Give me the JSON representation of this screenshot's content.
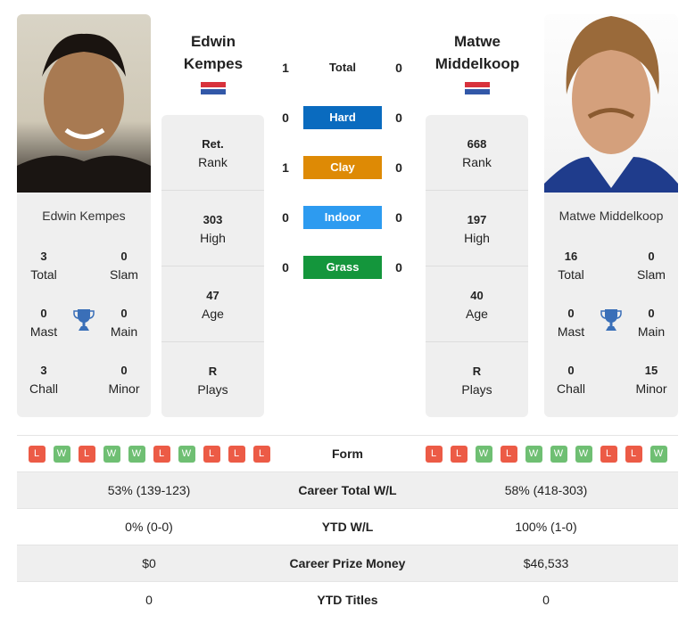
{
  "colors": {
    "hard": "#0a6bbf",
    "clay": "#de8a05",
    "indoor": "#2d9bf0",
    "grass": "#14963c",
    "win": "#6fbf73",
    "loss": "#ec5b46",
    "trophy": "#3a6fb8"
  },
  "player1": {
    "name_line1": "Edwin",
    "name_line2": "Kempes",
    "full_name": "Edwin Kempes",
    "country_flag": "netherlands-flag",
    "rank": "Ret.",
    "rank_label": "Rank",
    "high": "303",
    "high_label": "High",
    "age": "47",
    "age_label": "Age",
    "plays": "R",
    "plays_label": "Plays",
    "titles": {
      "total": "3",
      "total_label": "Total",
      "slam": "0",
      "slam_label": "Slam",
      "mast": "0",
      "mast_label": "Mast",
      "main": "0",
      "main_label": "Main",
      "chall": "3",
      "chall_label": "Chall",
      "minor": "0",
      "minor_label": "Minor"
    },
    "form": [
      "L",
      "W",
      "L",
      "W",
      "W",
      "L",
      "W",
      "L",
      "L",
      "L"
    ],
    "career_wl": "53% (139-123)",
    "ytd_wl": "0% (0-0)",
    "prize_money": "$0",
    "ytd_titles": "0"
  },
  "player2": {
    "name_line1": "Matwe",
    "name_line2": "Middelkoop",
    "full_name": "Matwe Middelkoop",
    "country_flag": "netherlands-flag",
    "rank": "668",
    "rank_label": "Rank",
    "high": "197",
    "high_label": "High",
    "age": "40",
    "age_label": "Age",
    "plays": "R",
    "plays_label": "Plays",
    "titles": {
      "total": "16",
      "total_label": "Total",
      "slam": "0",
      "slam_label": "Slam",
      "mast": "0",
      "mast_label": "Mast",
      "main": "0",
      "main_label": "Main",
      "chall": "0",
      "chall_label": "Chall",
      "minor": "15",
      "minor_label": "Minor"
    },
    "form": [
      "L",
      "L",
      "W",
      "L",
      "W",
      "W",
      "W",
      "L",
      "L",
      "W"
    ],
    "career_wl": "58% (418-303)",
    "ytd_wl": "100% (1-0)",
    "prize_money": "$46,533",
    "ytd_titles": "0"
  },
  "h2h": [
    {
      "label": "Total",
      "p1": "1",
      "p2": "0"
    },
    {
      "label": "Hard",
      "p1": "0",
      "p2": "0"
    },
    {
      "label": "Clay",
      "p1": "1",
      "p2": "0"
    },
    {
      "label": "Indoor",
      "p1": "0",
      "p2": "0"
    },
    {
      "label": "Grass",
      "p1": "0",
      "p2": "0"
    }
  ],
  "table_labels": {
    "form": "Form",
    "career_wl": "Career Total W/L",
    "ytd_wl": "YTD W/L",
    "prize_money": "Career Prize Money",
    "ytd_titles": "YTD Titles"
  }
}
